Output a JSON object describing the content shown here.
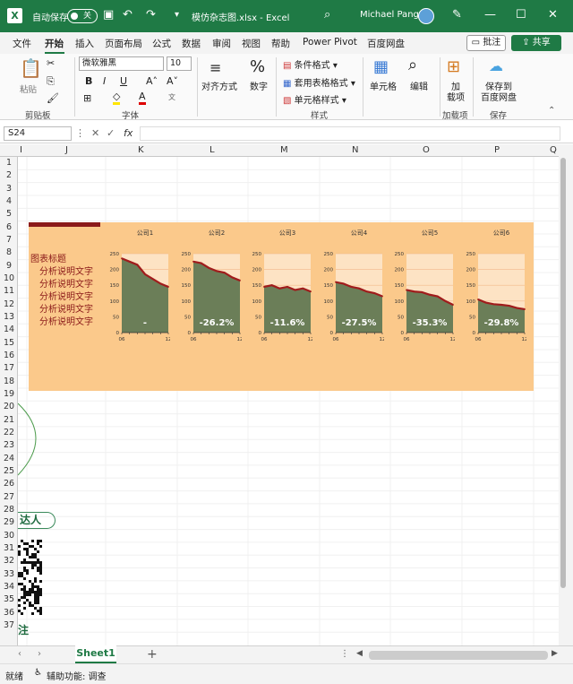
{
  "titlebar": {
    "autosave_label": "自动保存",
    "autosave_state": "关",
    "filename": "模仿杂志图.xlsx - Excel",
    "user": "Michael Pang"
  },
  "menu": [
    "文件",
    "开始",
    "插入",
    "页面布局",
    "公式",
    "数据",
    "审阅",
    "视图",
    "帮助",
    "Power Pivot",
    "百度网盘"
  ],
  "menu_active": "开始",
  "buttons": {
    "comment": "批注",
    "share": "共享"
  },
  "ribbon": {
    "paste": "粘贴",
    "font_name": "微软雅黑",
    "font_size": "10",
    "align": "对齐方式",
    "number": "数字",
    "cond_format": "条件格式",
    "table_format": "套用表格格式",
    "cell_style": "单元格样式",
    "cells": "单元格",
    "edit": "编辑",
    "addin": "加\n载项",
    "addin1": "加",
    "addin2": "载项",
    "save_baidu1": "保存到",
    "save_baidu2": "百度网盘",
    "groups": {
      "clipboard": "剪贴板",
      "font": "字体",
      "styles": "样式",
      "addins": "加载项",
      "save": "保存"
    }
  },
  "formula": {
    "namebox": "S24",
    "content": ""
  },
  "columns": [
    "I",
    "J",
    "K",
    "L",
    "M",
    "N",
    "O",
    "P",
    "Q"
  ],
  "rows": [
    "1",
    "2",
    "3",
    "4",
    "5",
    "6",
    "7",
    "8",
    "9",
    "10",
    "11",
    "12",
    "13",
    "14",
    "15",
    "16",
    "17",
    "18",
    "19",
    "20",
    "21",
    "22",
    "23",
    "24",
    "25",
    "26",
    "27",
    "28",
    "29",
    "30",
    "31",
    "32",
    "33",
    "34",
    "35",
    "36",
    "37"
  ],
  "panel": {
    "title": "图表标题",
    "descriptions": [
      "分析说明文字",
      "分析说明文字",
      "分析说明文字",
      "分析说明文字",
      "分析说明文字"
    ]
  },
  "side_text": {
    "daren": "达人",
    "zhu": "注"
  },
  "chart_data": [
    {
      "type": "area",
      "title": "公司1",
      "x": [
        "06",
        "07",
        "08",
        "09",
        "10",
        "11",
        "12"
      ],
      "values": [
        235,
        225,
        215,
        185,
        170,
        155,
        145
      ],
      "label": "-",
      "ylim": [
        0,
        250
      ],
      "yticks": [
        0,
        50,
        100,
        150,
        200,
        250
      ],
      "xticks": [
        "06",
        "12"
      ]
    },
    {
      "type": "area",
      "title": "公司2",
      "x": [
        "06",
        "07",
        "08",
        "09",
        "10",
        "11",
        "12"
      ],
      "values": [
        225,
        220,
        205,
        195,
        190,
        175,
        165
      ],
      "label": "-26.2%",
      "ylim": [
        0,
        250
      ],
      "yticks": [
        0,
        50,
        100,
        150,
        200,
        250
      ],
      "xticks": [
        "06",
        "12"
      ]
    },
    {
      "type": "area",
      "title": "公司3",
      "x": [
        "06",
        "07",
        "08",
        "09",
        "10",
        "11",
        "12"
      ],
      "values": [
        145,
        150,
        140,
        145,
        135,
        140,
        130
      ],
      "label": "-11.6%",
      "ylim": [
        0,
        250
      ],
      "yticks": [
        0,
        50,
        100,
        150,
        200,
        250
      ],
      "xticks": [
        "06",
        "12"
      ]
    },
    {
      "type": "area",
      "title": "公司4",
      "x": [
        "06",
        "07",
        "08",
        "09",
        "10",
        "11",
        "12"
      ],
      "values": [
        160,
        155,
        145,
        140,
        130,
        125,
        115
      ],
      "label": "-27.5%",
      "ylim": [
        0,
        250
      ],
      "yticks": [
        0,
        50,
        100,
        150,
        200,
        250
      ],
      "xticks": [
        "06",
        "12"
      ]
    },
    {
      "type": "area",
      "title": "公司5",
      "x": [
        "06",
        "07",
        "08",
        "09",
        "10",
        "11",
        "12"
      ],
      "values": [
        135,
        130,
        128,
        120,
        115,
        100,
        88
      ],
      "label": "-35.3%",
      "ylim": [
        0,
        250
      ],
      "yticks": [
        0,
        50,
        100,
        150,
        200,
        250
      ],
      "xticks": [
        "06",
        "12"
      ]
    },
    {
      "type": "area",
      "title": "公司6",
      "x": [
        "06",
        "07",
        "08",
        "09",
        "10",
        "11",
        "12"
      ],
      "values": [
        105,
        95,
        90,
        88,
        85,
        78,
        74
      ],
      "label": "-29.8%",
      "ylim": [
        0,
        250
      ],
      "yticks": [
        0,
        50,
        100,
        150,
        200,
        250
      ],
      "xticks": [
        "06",
        "12"
      ]
    }
  ],
  "colors": {
    "area": "#6b7e58",
    "line": "#a01c1c",
    "plot_bg": "#fde3c4",
    "panel": "#fbc98b",
    "brand": "#1f7a45"
  },
  "sheet": {
    "tab": "Sheet1"
  },
  "status": {
    "ready": "就绪",
    "accessibility": "辅助功能: 调查"
  }
}
